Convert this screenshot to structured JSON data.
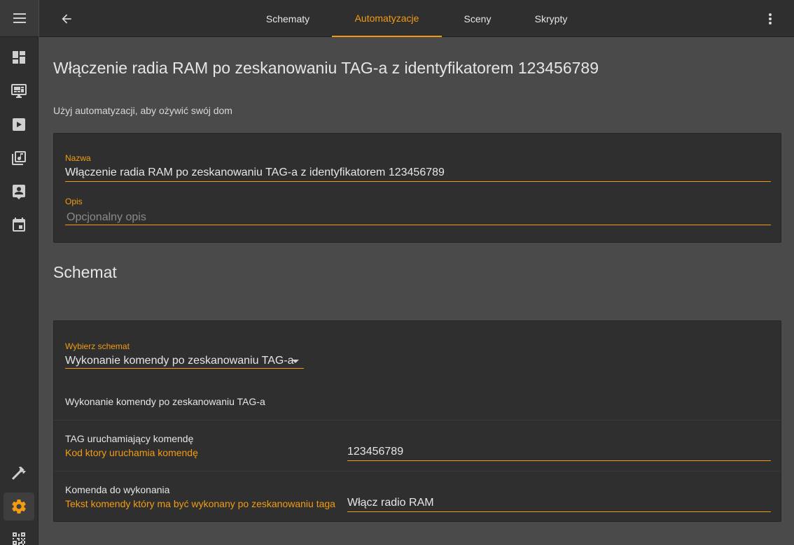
{
  "topbar": {
    "tabs": [
      {
        "label": "Schematy"
      },
      {
        "label": "Automatyzacje"
      },
      {
        "label": "Sceny"
      },
      {
        "label": "Skrypty"
      }
    ],
    "active_tab": "Automatyzacje"
  },
  "sidebar": {
    "items": [
      {
        "icon": "dashboard-icon"
      },
      {
        "icon": "monitor-dashboard-icon"
      },
      {
        "icon": "play-box-icon"
      },
      {
        "icon": "playlist-music-icon"
      },
      {
        "icon": "account-box-icon"
      },
      {
        "icon": "calendar-icon"
      },
      {
        "icon": "hammer-icon"
      },
      {
        "icon": "gear-icon"
      },
      {
        "icon": "qrcode-icon"
      }
    ],
    "active": "gear-icon"
  },
  "page": {
    "title": "Włączenie radia RAM po zeskanowaniu TAG-a z identyfikatorem 123456789",
    "intro": "Użyj automatyzacji, aby ożywić swój dom"
  },
  "details": {
    "name_label": "Nazwa",
    "name_value": "Włączenie radia RAM po zeskanowaniu TAG-a z identyfikatorem 123456789",
    "desc_label": "Opis",
    "desc_placeholder": "Opcjonalny opis"
  },
  "blueprint": {
    "section_title": "Schemat",
    "select_label": "Wybierz schemat",
    "select_value": "Wykonanie komendy po zeskanowaniu TAG-a",
    "description": "Wykonanie komendy po zeskanowaniu TAG-a",
    "inputs": [
      {
        "title": "TAG uruchamiający komendę",
        "subtitle": "Kod ktory uruchamia komendę",
        "value": "123456789"
      },
      {
        "title": "Komenda do wykonania",
        "subtitle": "Tekst komendy który ma być wykonany po zeskanowaniu taga",
        "value": "Włącz radio RAM"
      }
    ]
  },
  "colors": {
    "accent": "#f39c12",
    "background": "#4a4a4a",
    "card": "#2f2f2f",
    "sidebar": "#2f2f2f",
    "text": "#e6e6e6"
  }
}
